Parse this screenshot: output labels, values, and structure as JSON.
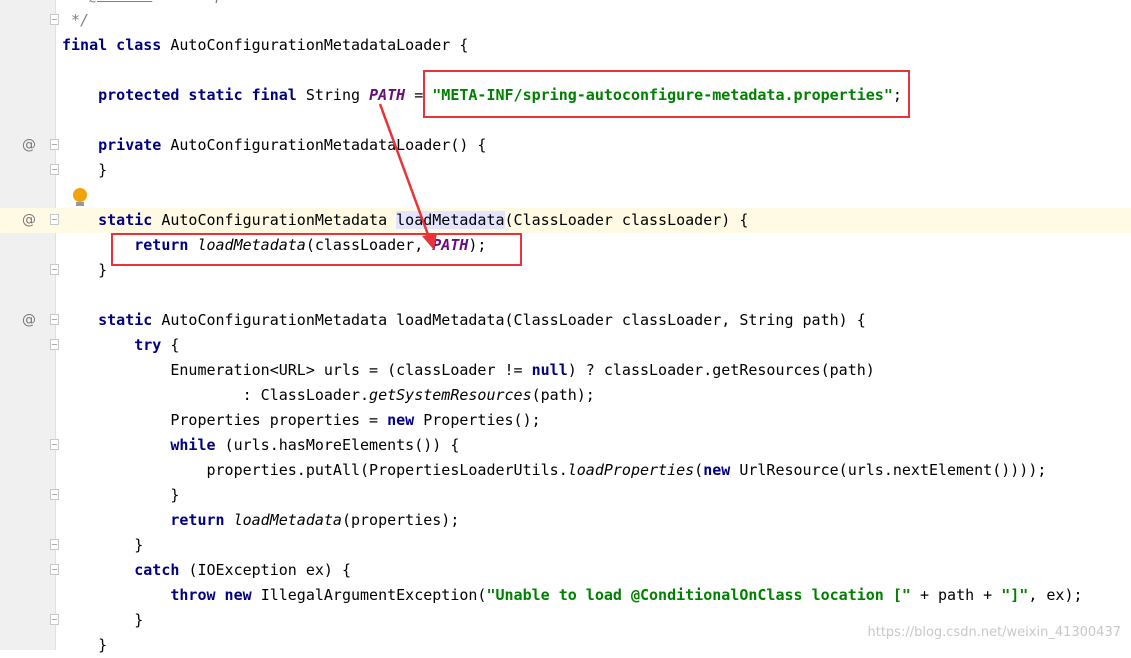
{
  "editor": {
    "lines": [
      {
        "tokens": [
          [
            "cmt",
            " * "
          ],
          [
            "tag",
            "@author"
          ],
          [
            "cmt",
            " Phillip Webb"
          ]
        ]
      },
      {
        "tokens": [
          [
            "cmt",
            " */"
          ]
        ],
        "fold": true
      },
      {
        "tokens": [
          [
            "kw",
            "final class "
          ],
          [
            "",
            "AutoConfigurationMetadataLoader {"
          ]
        ]
      },
      {
        "tokens": []
      },
      {
        "tokens": [
          [
            "",
            "    "
          ],
          [
            "kw",
            "protected static final "
          ],
          [
            "",
            "String "
          ],
          [
            "const",
            "PATH"
          ],
          [
            "",
            " = "
          ],
          [
            "str",
            "\"META-INF/spring-autoconfigure-metadata.properties\""
          ],
          [
            "",
            ";"
          ]
        ]
      },
      {
        "tokens": []
      },
      {
        "tokens": [
          [
            "",
            "    "
          ],
          [
            "kw",
            "private "
          ],
          [
            "",
            "AutoConfigurationMetadataLoader() {"
          ]
        ],
        "at": "@",
        "fold": true
      },
      {
        "tokens": [
          [
            "",
            "    }"
          ]
        ],
        "fold": true
      },
      {
        "tokens": []
      },
      {
        "tokens": [
          [
            "",
            "    "
          ],
          [
            "kw",
            "static "
          ],
          [
            "",
            "AutoConfigurationMetadata "
          ],
          [
            "hl",
            "loadMetadata"
          ],
          [
            "",
            "(ClassLoader classLoader) {"
          ]
        ],
        "at": "@",
        "fold": true,
        "current": true
      },
      {
        "tokens": [
          [
            "",
            "        "
          ],
          [
            "kw",
            "return "
          ],
          [
            "smeth",
            "loadMetadata"
          ],
          [
            "",
            "(classLoader, "
          ],
          [
            "const",
            "PATH"
          ],
          [
            "",
            ");"
          ]
        ]
      },
      {
        "tokens": [
          [
            "",
            "    }"
          ]
        ],
        "fold": true
      },
      {
        "tokens": []
      },
      {
        "tokens": [
          [
            "",
            "    "
          ],
          [
            "kw",
            "static "
          ],
          [
            "",
            "AutoConfigurationMetadata loadMetadata(ClassLoader classLoader, String path) {"
          ]
        ],
        "at": "@",
        "fold": true
      },
      {
        "tokens": [
          [
            "",
            "        "
          ],
          [
            "kw",
            "try "
          ],
          [
            "",
            "{"
          ]
        ],
        "fold": true
      },
      {
        "tokens": [
          [
            "",
            "            Enumeration<URL> urls = (classLoader != "
          ],
          [
            "kw",
            "null"
          ],
          [
            "",
            ") ? classLoader.getResources(path)"
          ]
        ]
      },
      {
        "tokens": [
          [
            "",
            "                    : ClassLoader."
          ],
          [
            "smeth",
            "getSystemResources"
          ],
          [
            "",
            "(path);"
          ]
        ]
      },
      {
        "tokens": [
          [
            "",
            "            Properties properties = "
          ],
          [
            "kw",
            "new "
          ],
          [
            "",
            "Properties();"
          ]
        ]
      },
      {
        "tokens": [
          [
            "",
            "            "
          ],
          [
            "kw",
            "while "
          ],
          [
            "",
            "(urls.hasMoreElements()) {"
          ]
        ],
        "fold": true
      },
      {
        "tokens": [
          [
            "",
            "                properties.putAll(PropertiesLoaderUtils."
          ],
          [
            "smeth",
            "loadProperties"
          ],
          [
            "",
            "("
          ],
          [
            "kw",
            "new "
          ],
          [
            "",
            "UrlResource(urls.nextElement())));"
          ]
        ]
      },
      {
        "tokens": [
          [
            "",
            "            }"
          ]
        ],
        "fold": true
      },
      {
        "tokens": [
          [
            "",
            "            "
          ],
          [
            "kw",
            "return "
          ],
          [
            "smeth",
            "loadMetadata"
          ],
          [
            "",
            "(properties);"
          ]
        ]
      },
      {
        "tokens": [
          [
            "",
            "        }"
          ]
        ],
        "fold": true
      },
      {
        "tokens": [
          [
            "",
            "        "
          ],
          [
            "kw",
            "catch "
          ],
          [
            "",
            "(IOException ex) {"
          ]
        ],
        "fold": true
      },
      {
        "tokens": [
          [
            "",
            "            "
          ],
          [
            "kw",
            "throw new "
          ],
          [
            "",
            "IllegalArgumentException("
          ],
          [
            "str",
            "\"Unable to load @ConditionalOnClass location [\""
          ],
          [
            "",
            " + path + "
          ],
          [
            "str",
            "\"]\""
          ],
          [
            "",
            ", ex);"
          ]
        ]
      },
      {
        "tokens": [
          [
            "",
            "        }"
          ]
        ],
        "fold": true
      },
      {
        "tokens": [
          [
            "",
            "    }"
          ]
        ]
      }
    ]
  },
  "annotation_color": "#e8333a",
  "watermark": "https://blog.csdn.net/weixin_41300437"
}
